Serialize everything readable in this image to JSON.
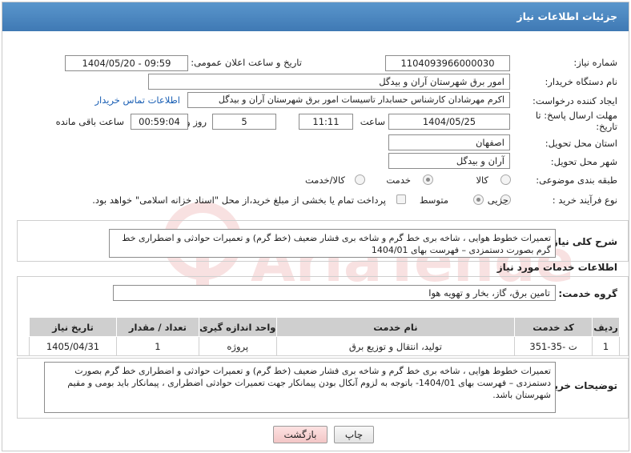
{
  "header": {
    "title": "جزئیات اطلاعات نیاز"
  },
  "fields": {
    "need_number_label": "شماره نیاز:",
    "need_number": "1104093966000030",
    "announce_label": "تاریخ و ساعت اعلان عمومی:",
    "announce_value": "1404/05/20 - 09:59",
    "buyer_org_label": "نام دستگاه خریدار:",
    "buyer_org": "امور برق شهرستان آران و بیدگل",
    "requester_label": "ایجاد کننده درخواست:",
    "requester": "اکرم مهرشادان کارشناس حسابدار تاسیسات امور برق شهرستان آران و بیدگل",
    "contact_link": "اطلاعات تماس خریدار",
    "deadline_label_1": "مهلت ارسال پاسخ: تا",
    "deadline_label_2": "تاریخ:",
    "deadline_date": "1404/05/25",
    "time_label": "ساعت",
    "deadline_time": "11:11",
    "days_value": "5",
    "days_label": "روز و",
    "remaining_time": "00:59:04",
    "remaining_label": "ساعت باقی مانده",
    "province_label": "استان محل تحویل:",
    "province": "اصفهان",
    "city_label": "شهر محل تحویل:",
    "city": "آران و بیدگل",
    "category_label": "طبقه بندی موضوعی:",
    "category_options": [
      "کالا",
      "خدمت",
      "کالا/خدمت"
    ],
    "process_label": "نوع فرآیند خرید :",
    "process_options": [
      "جزیی",
      "متوسط"
    ],
    "payment_note": "پرداخت تمام یا بخشی از مبلغ خرید،از محل \"اسناد خزانه اسلامی\" خواهد بود."
  },
  "summary": {
    "label": "شرح کلی نیاز:",
    "text": "تعمیرات خطوط هوایی ، شاخه بری خط گرم  و  شاخه بری فشار ضعیف  (خط گرم) و تعمیرات حوادثی و اضطراری خط گرم بصورت دستمزدی – فهرست بهای 1404/01"
  },
  "services": {
    "section_title": "اطلاعات خدمات مورد نیاز",
    "group_label": "گروه خدمت:",
    "group_value": "تامین برق، گاز، بخار و تهویه هوا",
    "columns": [
      "ردیف",
      "کد خدمت",
      "نام خدمت",
      "واحد اندازه گیری",
      "تعداد / مقدار",
      "تاریخ نیاز"
    ],
    "rows": [
      [
        "1",
        "ت -35-351",
        "تولید، انتقال و توزیع برق",
        "پروژه",
        "1",
        "1405/04/31"
      ]
    ]
  },
  "buyer_notes": {
    "label": "توضیحات خریدار:",
    "text": "تعمیرات خطوط هوایی ، شاخه بری خط گرم  و  شاخه بری فشار ضعیف  (خط گرم) و تعمیرات حوادثی و اضطراری خط گرم بصورت دستمزدی – فهرست بهای 1404/01- باتوجه به لزوم آنکال بودن پیمانکار جهت تعمیرات حوادثی اضطراری ، پیمانکار باید بومی و مقیم شهرستان باشد."
  },
  "buttons": {
    "print": "چاپ",
    "back": "بازگشت"
  },
  "watermark_text": "AriaTender.neT",
  "colors": {
    "header": "#4a86c0",
    "link": "#1a5fb4",
    "watermark": "#d03030"
  }
}
